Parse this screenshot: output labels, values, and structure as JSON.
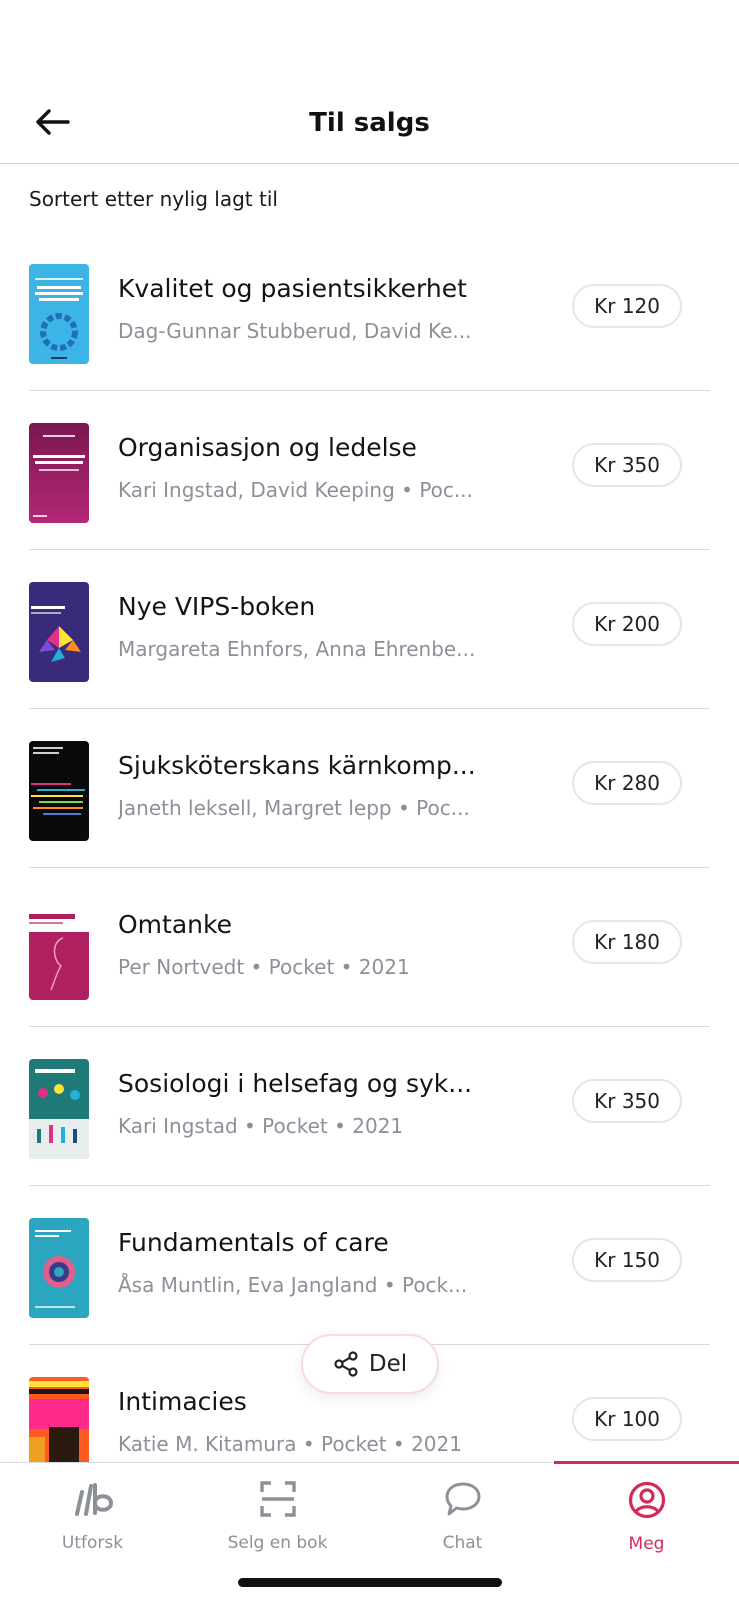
{
  "header": {
    "title": "Til salgs",
    "back_icon": "arrow-left-icon"
  },
  "sort_label": "Sortert etter nylig lagt til",
  "books": [
    {
      "title": "Kvalitet og pasientsikkerhet",
      "meta": "Dag-Gunnar Stubberud, David Ke...",
      "price": "Kr 120",
      "cover_color": "#3cb5e6"
    },
    {
      "title": "Organisasjon og ledelse",
      "meta": "Kari Ingstad, David Keeping • Poc...",
      "price": "Kr 350",
      "cover_color": "#8c1b5e"
    },
    {
      "title": "Nye VIPS-boken",
      "meta": "Margareta Ehnfors, Anna Ehrenbe...",
      "price": "Kr 200",
      "cover_color": "#3a2a7a"
    },
    {
      "title": "Sjuksköterskans kärnkomp...",
      "meta": "Janeth leksell, Margret lepp • Poc...",
      "price": "Kr 280",
      "cover_color": "#0a0a0a"
    },
    {
      "title": "Omtanke",
      "meta": "Per Nortvedt • Pocket • 2021",
      "price": "Kr 180",
      "cover_color": "#b01f5f"
    },
    {
      "title": "Sosiologi i  helsefag og syk...",
      "meta": "Kari Ingstad • Pocket • 2021",
      "price": "Kr 350",
      "cover_color": "#1f7a78"
    },
    {
      "title": "Fundamentals of care",
      "meta": "Åsa Muntlin, Eva Jangland • Pock...",
      "price": "Kr 150",
      "cover_color": "#2aa6c0"
    },
    {
      "title": "Intimacies",
      "meta": "Katie M. Kitamura • Pocket • 2021",
      "price": "Kr 100",
      "cover_color": "#ff5a1f"
    }
  ],
  "share_button": {
    "label": "Del",
    "icon": "share-icon"
  },
  "tabbar": {
    "tabs": [
      {
        "label": "Utforsk",
        "icon": "lb-logo-icon",
        "active": false
      },
      {
        "label": "Selg en bok",
        "icon": "scan-icon",
        "active": false
      },
      {
        "label": "Chat",
        "icon": "chat-bubble-icon",
        "active": false
      },
      {
        "label": "Meg",
        "icon": "user-profile-icon",
        "active": true
      }
    ]
  },
  "colors": {
    "accent": "#d42a58",
    "muted_text": "#8c9099",
    "divider": "#d6dae0"
  }
}
